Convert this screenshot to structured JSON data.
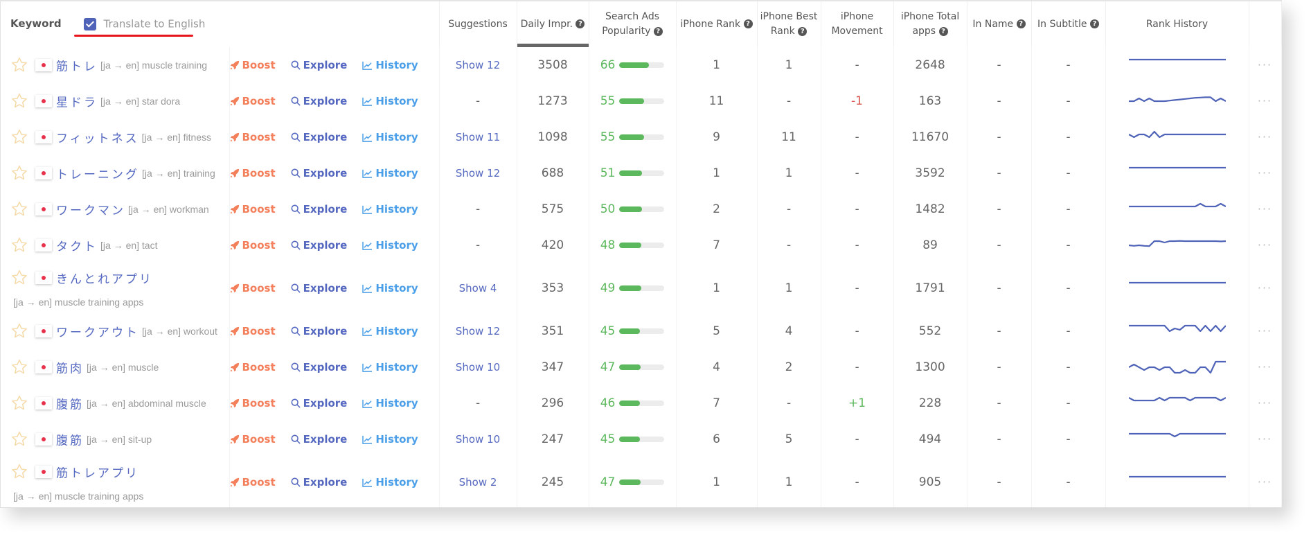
{
  "header": {
    "keyword": "Keyword",
    "translate_label": "Translate to English",
    "translate_checked": true,
    "columns": [
      {
        "key": "suggestions",
        "label": "Suggestions",
        "help": false
      },
      {
        "key": "daily_impr",
        "label": "Daily Impr.",
        "help": true,
        "sorted": true
      },
      {
        "key": "search_ads",
        "label": "Search Ads Popularity",
        "help": true
      },
      {
        "key": "iphone_rank",
        "label": "iPhone Rank",
        "help": true
      },
      {
        "key": "best_rank",
        "label": "iPhone Best Rank",
        "help": true
      },
      {
        "key": "movement",
        "label": "iPhone Movement",
        "help": false
      },
      {
        "key": "total_apps",
        "label": "iPhone Total apps",
        "help": true
      },
      {
        "key": "in_name",
        "label": "In Name",
        "help": true
      },
      {
        "key": "in_subtitle",
        "label": "In Subtitle",
        "help": true
      },
      {
        "key": "rank_history",
        "label": "Rank History",
        "help": false
      }
    ]
  },
  "actions": {
    "boost": "Boost",
    "explore": "Explore",
    "history": "History",
    "more": "···"
  },
  "colors": {
    "accent": "#5468c0",
    "boost": "#f47f5b",
    "history": "#4a9fe8",
    "popularity": "#5cb85c",
    "negative": "#d9534f",
    "positive": "#5cb85c",
    "sparkline": "#4f63b8"
  },
  "rows": [
    {
      "keyword": "筋トレ",
      "translation": "[ja → en] muscle training",
      "wrap": false,
      "suggestions": "Show 12",
      "daily_impr": "3508",
      "popularity": 66,
      "iphone_rank": "1",
      "best_rank": "1",
      "movement": "-",
      "total_apps": "2648",
      "in_name": "-",
      "in_subtitle": "-",
      "history": [
        1,
        1,
        1,
        1,
        1,
        1,
        1,
        1,
        1,
        1,
        1,
        1,
        1,
        1,
        1,
        1,
        1,
        1,
        1,
        1
      ]
    },
    {
      "keyword": "星ドラ",
      "translation": "[ja → en] star dora",
      "wrap": false,
      "suggestions": "-",
      "daily_impr": "1273",
      "popularity": 55,
      "iphone_rank": "11",
      "best_rank": "-",
      "movement": "-1",
      "total_apps": "163",
      "in_name": "-",
      "in_subtitle": "-",
      "history": [
        3,
        3,
        2,
        3,
        2,
        3,
        3,
        3,
        2.8,
        2.6,
        2.4,
        2.2,
        2,
        1.8,
        1.7,
        1.6,
        1.6,
        3,
        2,
        3
      ]
    },
    {
      "keyword": "フィットネス",
      "translation": "[ja → en] fitness",
      "wrap": false,
      "suggestions": "Show 11",
      "daily_impr": "1098",
      "popularity": 55,
      "iphone_rank": "9",
      "best_rank": "11",
      "movement": "-",
      "total_apps": "11670",
      "in_name": "-",
      "in_subtitle": "-",
      "history": [
        2,
        3,
        2,
        2,
        3,
        1,
        3,
        2,
        2,
        2,
        2,
        2,
        2,
        2,
        2,
        2,
        2,
        2,
        2,
        2
      ]
    },
    {
      "keyword": "トレーニング",
      "translation": "[ja → en] training",
      "wrap": false,
      "suggestions": "Show 12",
      "daily_impr": "688",
      "popularity": 51,
      "iphone_rank": "1",
      "best_rank": "1",
      "movement": "-",
      "total_apps": "3592",
      "in_name": "-",
      "in_subtitle": "-",
      "history": [
        1,
        1,
        1,
        1,
        1,
        1,
        1,
        1,
        1,
        1,
        1,
        1,
        1,
        1,
        1,
        1,
        1,
        1,
        1,
        1
      ]
    },
    {
      "keyword": "ワークマン",
      "translation": "[ja → en] workman",
      "wrap": false,
      "suggestions": "-",
      "daily_impr": "575",
      "popularity": 50,
      "iphone_rank": "2",
      "best_rank": "-",
      "movement": "-",
      "total_apps": "1482",
      "in_name": "-",
      "in_subtitle": "-",
      "history": [
        2,
        2,
        2,
        2,
        2,
        2,
        2,
        2,
        2,
        2,
        2,
        2,
        2,
        2,
        1,
        2,
        2,
        2,
        1,
        2
      ]
    },
    {
      "keyword": "タクト",
      "translation": "[ja → en] tact",
      "wrap": false,
      "suggestions": "-",
      "daily_impr": "420",
      "popularity": 48,
      "iphone_rank": "7",
      "best_rank": "-",
      "movement": "-",
      "total_apps": "89",
      "in_name": "-",
      "in_subtitle": "-",
      "history": [
        3,
        3.2,
        3,
        3.2,
        3.3,
        1.5,
        1.5,
        2,
        1.5,
        1.5,
        1.4,
        1.5,
        1.5,
        1.5,
        1.5,
        1.5,
        1.5,
        1.5,
        1.6,
        1.5
      ]
    },
    {
      "keyword": "きんとれアプリ",
      "translation": "[ja → en] muscle training apps",
      "wrap": true,
      "suggestions": "Show 4",
      "daily_impr": "353",
      "popularity": 49,
      "iphone_rank": "1",
      "best_rank": "1",
      "movement": "-",
      "total_apps": "1791",
      "in_name": "-",
      "in_subtitle": "-",
      "history": [
        1,
        1,
        1,
        1,
        1,
        1,
        1,
        1,
        1,
        1,
        1,
        1,
        1,
        1,
        1,
        1,
        1,
        1,
        1,
        1
      ]
    },
    {
      "keyword": "ワークアウト",
      "translation": "[ja → en] workout",
      "wrap": false,
      "suggestions": "Show 12",
      "daily_impr": "351",
      "popularity": 45,
      "iphone_rank": "5",
      "best_rank": "4",
      "movement": "-",
      "total_apps": "552",
      "in_name": "-",
      "in_subtitle": "-",
      "history": [
        1,
        1,
        1,
        1,
        1,
        1,
        1,
        1,
        3,
        2,
        2.5,
        1,
        1,
        1,
        3,
        1,
        3,
        1,
        3,
        1
      ]
    },
    {
      "keyword": "筋肉",
      "translation": "[ja → en] muscle",
      "wrap": false,
      "suggestions": "Show 10",
      "daily_impr": "347",
      "popularity": 47,
      "iphone_rank": "4",
      "best_rank": "2",
      "movement": "-",
      "total_apps": "1300",
      "in_name": "-",
      "in_subtitle": "-",
      "history": [
        3,
        2,
        3,
        4,
        3,
        3,
        4,
        3,
        3,
        5,
        5,
        4,
        5,
        5,
        3,
        3,
        5,
        1,
        1,
        1
      ]
    },
    {
      "keyword": "腹筋",
      "translation": "[ja → en] abdominal muscle",
      "wrap": false,
      "suggestions": "-",
      "daily_impr": "296",
      "popularity": 46,
      "iphone_rank": "7",
      "best_rank": "-",
      "movement": "+1",
      "total_apps": "228",
      "in_name": "-",
      "in_subtitle": "-",
      "history": [
        1,
        2,
        2,
        2,
        2,
        2,
        1,
        2,
        1,
        1,
        1,
        1,
        2,
        1,
        1,
        1,
        1,
        1,
        2,
        1
      ]
    },
    {
      "keyword": "腹筋",
      "translation": "[ja → en] sit-up",
      "wrap": false,
      "suggestions": "Show 10",
      "daily_impr": "247",
      "popularity": 45,
      "iphone_rank": "6",
      "best_rank": "5",
      "movement": "-",
      "total_apps": "494",
      "in_name": "-",
      "in_subtitle": "-",
      "history": [
        1,
        1,
        1,
        1,
        1,
        1,
        1,
        1,
        1,
        2,
        1,
        1,
        1,
        1,
        1,
        1,
        1,
        1,
        1,
        1
      ]
    },
    {
      "keyword": "筋トレアプリ",
      "translation": "[ja → en] muscle training apps",
      "wrap": true,
      "suggestions": "Show 2",
      "daily_impr": "245",
      "popularity": 47,
      "iphone_rank": "1",
      "best_rank": "1",
      "movement": "-",
      "total_apps": "905",
      "in_name": "-",
      "in_subtitle": "-",
      "history": [
        1,
        1,
        1,
        1,
        1,
        1,
        1,
        1,
        1,
        1,
        1,
        1,
        1,
        1,
        1,
        1,
        1,
        1,
        1,
        1
      ]
    }
  ]
}
